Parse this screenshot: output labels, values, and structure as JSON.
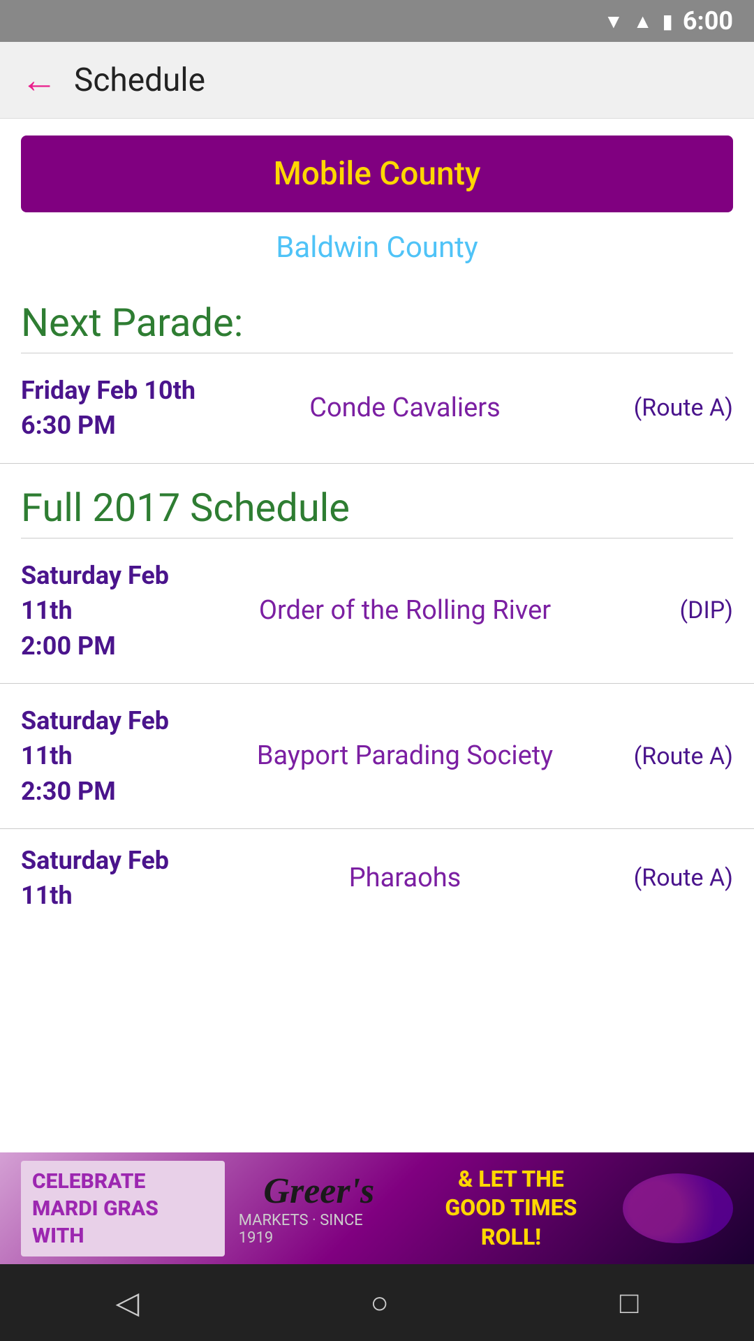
{
  "statusBar": {
    "time": "6:00"
  },
  "appBar": {
    "backLabel": "←",
    "title": "Schedule"
  },
  "tabs": [
    {
      "label": "Mobile County",
      "active": true
    },
    {
      "label": "Baldwin County",
      "active": false
    }
  ],
  "nextParade": {
    "heading": "Next Parade:",
    "row": {
      "date": "Friday Feb 10th",
      "time": "6:30 PM",
      "name": "Conde Cavaliers",
      "route": "(Route A)"
    }
  },
  "fullSchedule": {
    "heading": "Full 2017 Schedule",
    "rows": [
      {
        "date": "Saturday Feb 11th",
        "time": "2:00 PM",
        "name": "Order of the Rolling River",
        "route": "(DIP)"
      },
      {
        "date": "Saturday Feb 11th",
        "time": "2:30 PM",
        "name": "Bayport Parading Society",
        "route": "(Route A)"
      },
      {
        "date": "Saturday Feb 11th",
        "time": "",
        "name": "Pharaohs",
        "route": "(Route A)"
      }
    ]
  },
  "adBanner": {
    "leftText": "CELEBRATE\nMARDI GRAS WITH",
    "logoText": "Greer's",
    "subText": "MARKETS · SINCE 1919",
    "rightText": "& LET THE\nGOOD TIMES ROLL!"
  },
  "navBar": {
    "back": "◁",
    "home": "○",
    "recent": "□"
  }
}
